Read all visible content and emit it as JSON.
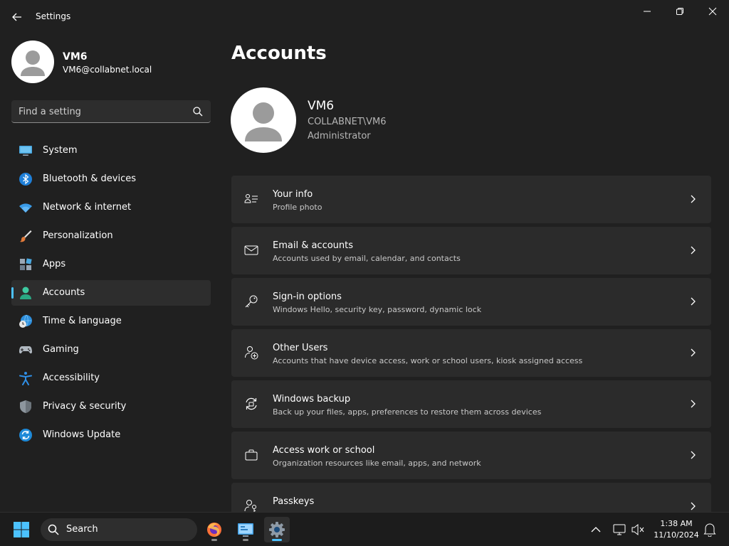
{
  "window": {
    "title": "Settings",
    "icons": {
      "back": "back-arrow-icon",
      "minimize": "minimize-icon",
      "maximize": "restore-icon",
      "close": "close-icon"
    }
  },
  "sidebar": {
    "profile": {
      "name": "VM6",
      "email": "VM6@collabnet.local"
    },
    "search": {
      "placeholder": "Find a setting"
    },
    "items": [
      {
        "label": "System",
        "icon": "system-icon"
      },
      {
        "label": "Bluetooth & devices",
        "icon": "bluetooth-icon"
      },
      {
        "label": "Network & internet",
        "icon": "wifi-icon"
      },
      {
        "label": "Personalization",
        "icon": "brush-icon"
      },
      {
        "label": "Apps",
        "icon": "apps-icon"
      },
      {
        "label": "Accounts",
        "icon": "person-icon",
        "active": true
      },
      {
        "label": "Time & language",
        "icon": "globe-clock-icon"
      },
      {
        "label": "Gaming",
        "icon": "gamepad-icon"
      },
      {
        "label": "Accessibility",
        "icon": "accessibility-icon"
      },
      {
        "label": "Privacy & security",
        "icon": "shield-icon"
      },
      {
        "label": "Windows Update",
        "icon": "update-icon"
      }
    ]
  },
  "main": {
    "title": "Accounts",
    "account": {
      "name": "VM6",
      "domain": "COLLABNET\\VM6",
      "role": "Administrator"
    },
    "cards": [
      {
        "title": "Your info",
        "subtitle": "Profile photo",
        "icon": "person-card-icon"
      },
      {
        "title": "Email & accounts",
        "subtitle": "Accounts used by email, calendar, and contacts",
        "icon": "mail-icon"
      },
      {
        "title": "Sign-in options",
        "subtitle": "Windows Hello, security key, password, dynamic lock",
        "icon": "key-icon"
      },
      {
        "title": "Other Users",
        "subtitle": "Accounts that have device access, work or school users, kiosk assigned access",
        "icon": "person-add-icon"
      },
      {
        "title": "Windows backup",
        "subtitle": "Back up your files, apps, preferences to restore them across devices",
        "icon": "backup-icon"
      },
      {
        "title": "Access work or school",
        "subtitle": "Organization resources like email, apps, and network",
        "icon": "briefcase-icon"
      },
      {
        "title": "Passkeys",
        "subtitle": "",
        "icon": "passkey-icon"
      }
    ]
  },
  "taskbar": {
    "search_label": "Search",
    "apps": [
      {
        "name": "firefox-icon",
        "active": false
      },
      {
        "name": "control-panel-icon",
        "active": false
      },
      {
        "name": "settings-gear-icon",
        "active": true
      }
    ],
    "clock": {
      "time": "1:38 AM",
      "date": "11/10/2024"
    }
  },
  "colors": {
    "accent": "#4cc2ff",
    "background": "#202020",
    "card": "#2b2b2b"
  }
}
